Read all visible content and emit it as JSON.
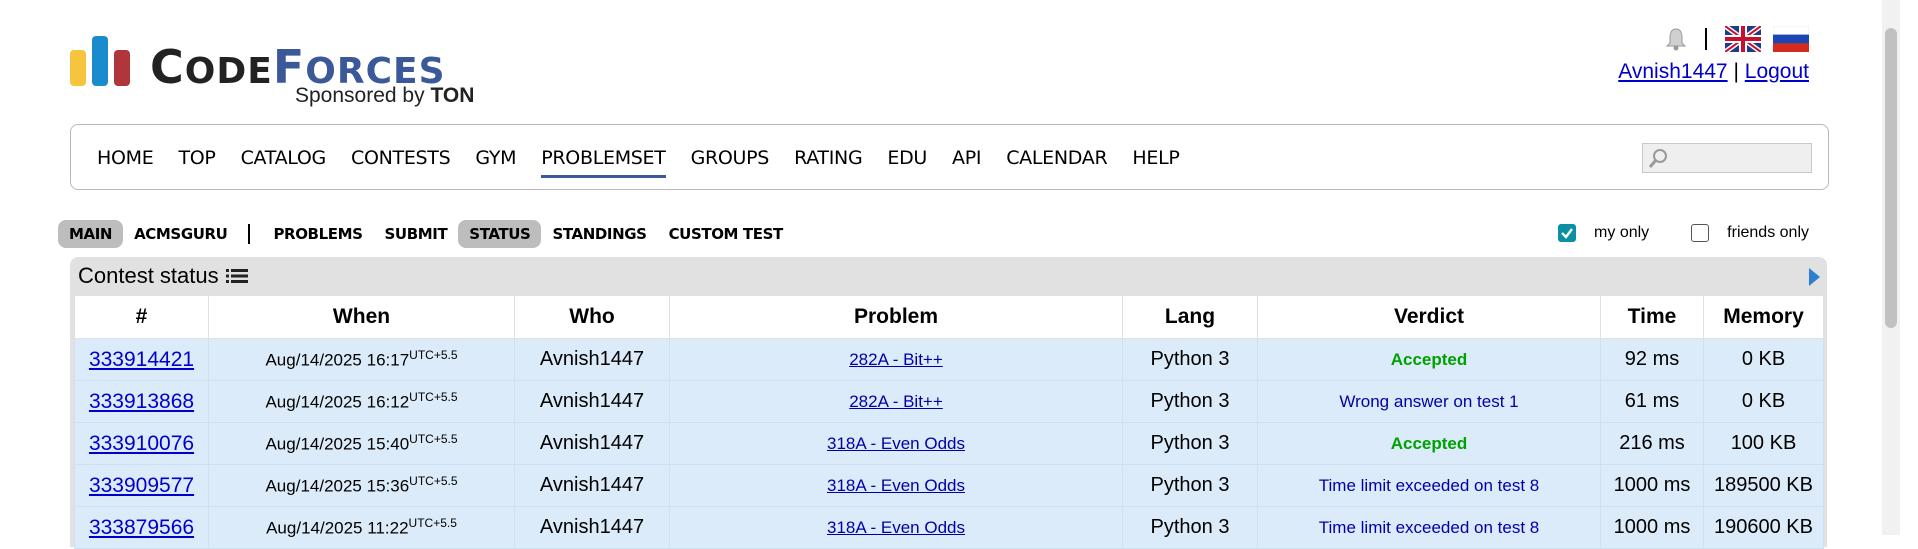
{
  "brand": {
    "word_big_1": "C",
    "word_small_1": "ODE",
    "word_big_2": "F",
    "word_small_2": "ORCES",
    "sponsor_prefix": "Sponsored by ",
    "sponsor_name": "TON",
    "colors": {
      "yellow": "#f6c43d",
      "blue": "#1a8ccd",
      "red": "#b1363b",
      "dark": "#222222",
      "accent": "#3b5998"
    }
  },
  "header": {
    "username": "Avnish1447",
    "separator": "|",
    "logout": "Logout"
  },
  "main_menu": [
    "HOME",
    "TOP",
    "CATALOG",
    "CONTESTS",
    "GYM",
    "PROBLEMSET",
    "GROUPS",
    "RATING",
    "EDU",
    "API",
    "CALENDAR",
    "HELP"
  ],
  "main_menu_active": "PROBLEMSET",
  "sub_menu": {
    "group1": [
      "MAIN",
      "ACMSGURU"
    ],
    "group2": [
      "PROBLEMS",
      "SUBMIT",
      "STATUS",
      "STANDINGS",
      "CUSTOM TEST"
    ]
  },
  "filters": {
    "my_only": "my only",
    "friends_only": "friends only",
    "my_only_checked": true,
    "friends_only_checked": false
  },
  "panel": {
    "title": "Contest status"
  },
  "table": {
    "headers": [
      "#",
      "When",
      "Who",
      "Problem",
      "Lang",
      "Verdict",
      "Time",
      "Memory"
    ],
    "rows": [
      {
        "id": "333914421",
        "when": "Aug/14/2025 16:17",
        "tz": "UTC+5.5",
        "who": "Avnish1447",
        "problem": "282A - Bit++",
        "lang": "Python 3",
        "verdict": "Accepted",
        "accepted": true,
        "time": "92 ms",
        "memory": "0 KB"
      },
      {
        "id": "333913868",
        "when": "Aug/14/2025 16:12",
        "tz": "UTC+5.5",
        "who": "Avnish1447",
        "problem": "282A - Bit++",
        "lang": "Python 3",
        "verdict": "Wrong answer on test 1",
        "accepted": false,
        "time": "61 ms",
        "memory": "0 KB"
      },
      {
        "id": "333910076",
        "when": "Aug/14/2025 15:40",
        "tz": "UTC+5.5",
        "who": "Avnish1447",
        "problem": "318A - Even Odds",
        "lang": "Python 3",
        "verdict": "Accepted",
        "accepted": true,
        "time": "216 ms",
        "memory": "100 KB"
      },
      {
        "id": "333909577",
        "when": "Aug/14/2025 15:36",
        "tz": "UTC+5.5",
        "who": "Avnish1447",
        "problem": "318A - Even Odds",
        "lang": "Python 3",
        "verdict": "Time limit exceeded on test 8",
        "accepted": false,
        "time": "1000 ms",
        "memory": "189500 KB"
      },
      {
        "id": "333879566",
        "when": "Aug/14/2025 11:22",
        "tz": "UTC+5.5",
        "who": "Avnish1447",
        "problem": "318A - Even Odds",
        "lang": "Python 3",
        "verdict": "Time limit exceeded on test 8",
        "accepted": false,
        "time": "1000 ms",
        "memory": "190600 KB"
      }
    ]
  },
  "icons": {
    "bell": "bell-icon",
    "flag_en": "uk-flag-icon",
    "flag_ru": "russia-flag-icon",
    "search": "search-icon",
    "list": "list-icon",
    "expand": "arrow-right-icon"
  }
}
